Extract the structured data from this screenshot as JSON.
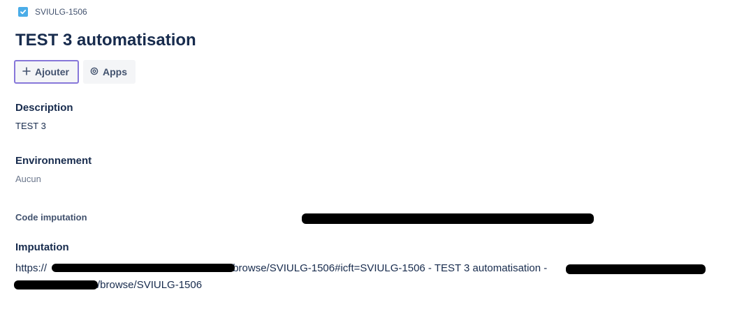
{
  "breadcrumb": {
    "issue_key": "SVIULG-1506"
  },
  "title": "TEST 3 automatisation",
  "actions": {
    "add_label": "Ajouter",
    "apps_label": "Apps"
  },
  "description": {
    "label": "Description",
    "value": "TEST 3"
  },
  "environment": {
    "label": "Environnement",
    "value": "Aucun"
  },
  "code_imputation": {
    "label": "Code imputation"
  },
  "imputation": {
    "label": "Imputation",
    "line1_prefix": "https://",
    "line1_middle": "/browse/SVIULG-1506#icft=SVIULG-1506 - TEST 3 automatisation - ",
    "line2_suffix": "/browse/SVIULG-1506"
  },
  "colors": {
    "accent_border": "#8777d9",
    "issue_icon": "#4bade8",
    "text": "#172b4d"
  }
}
